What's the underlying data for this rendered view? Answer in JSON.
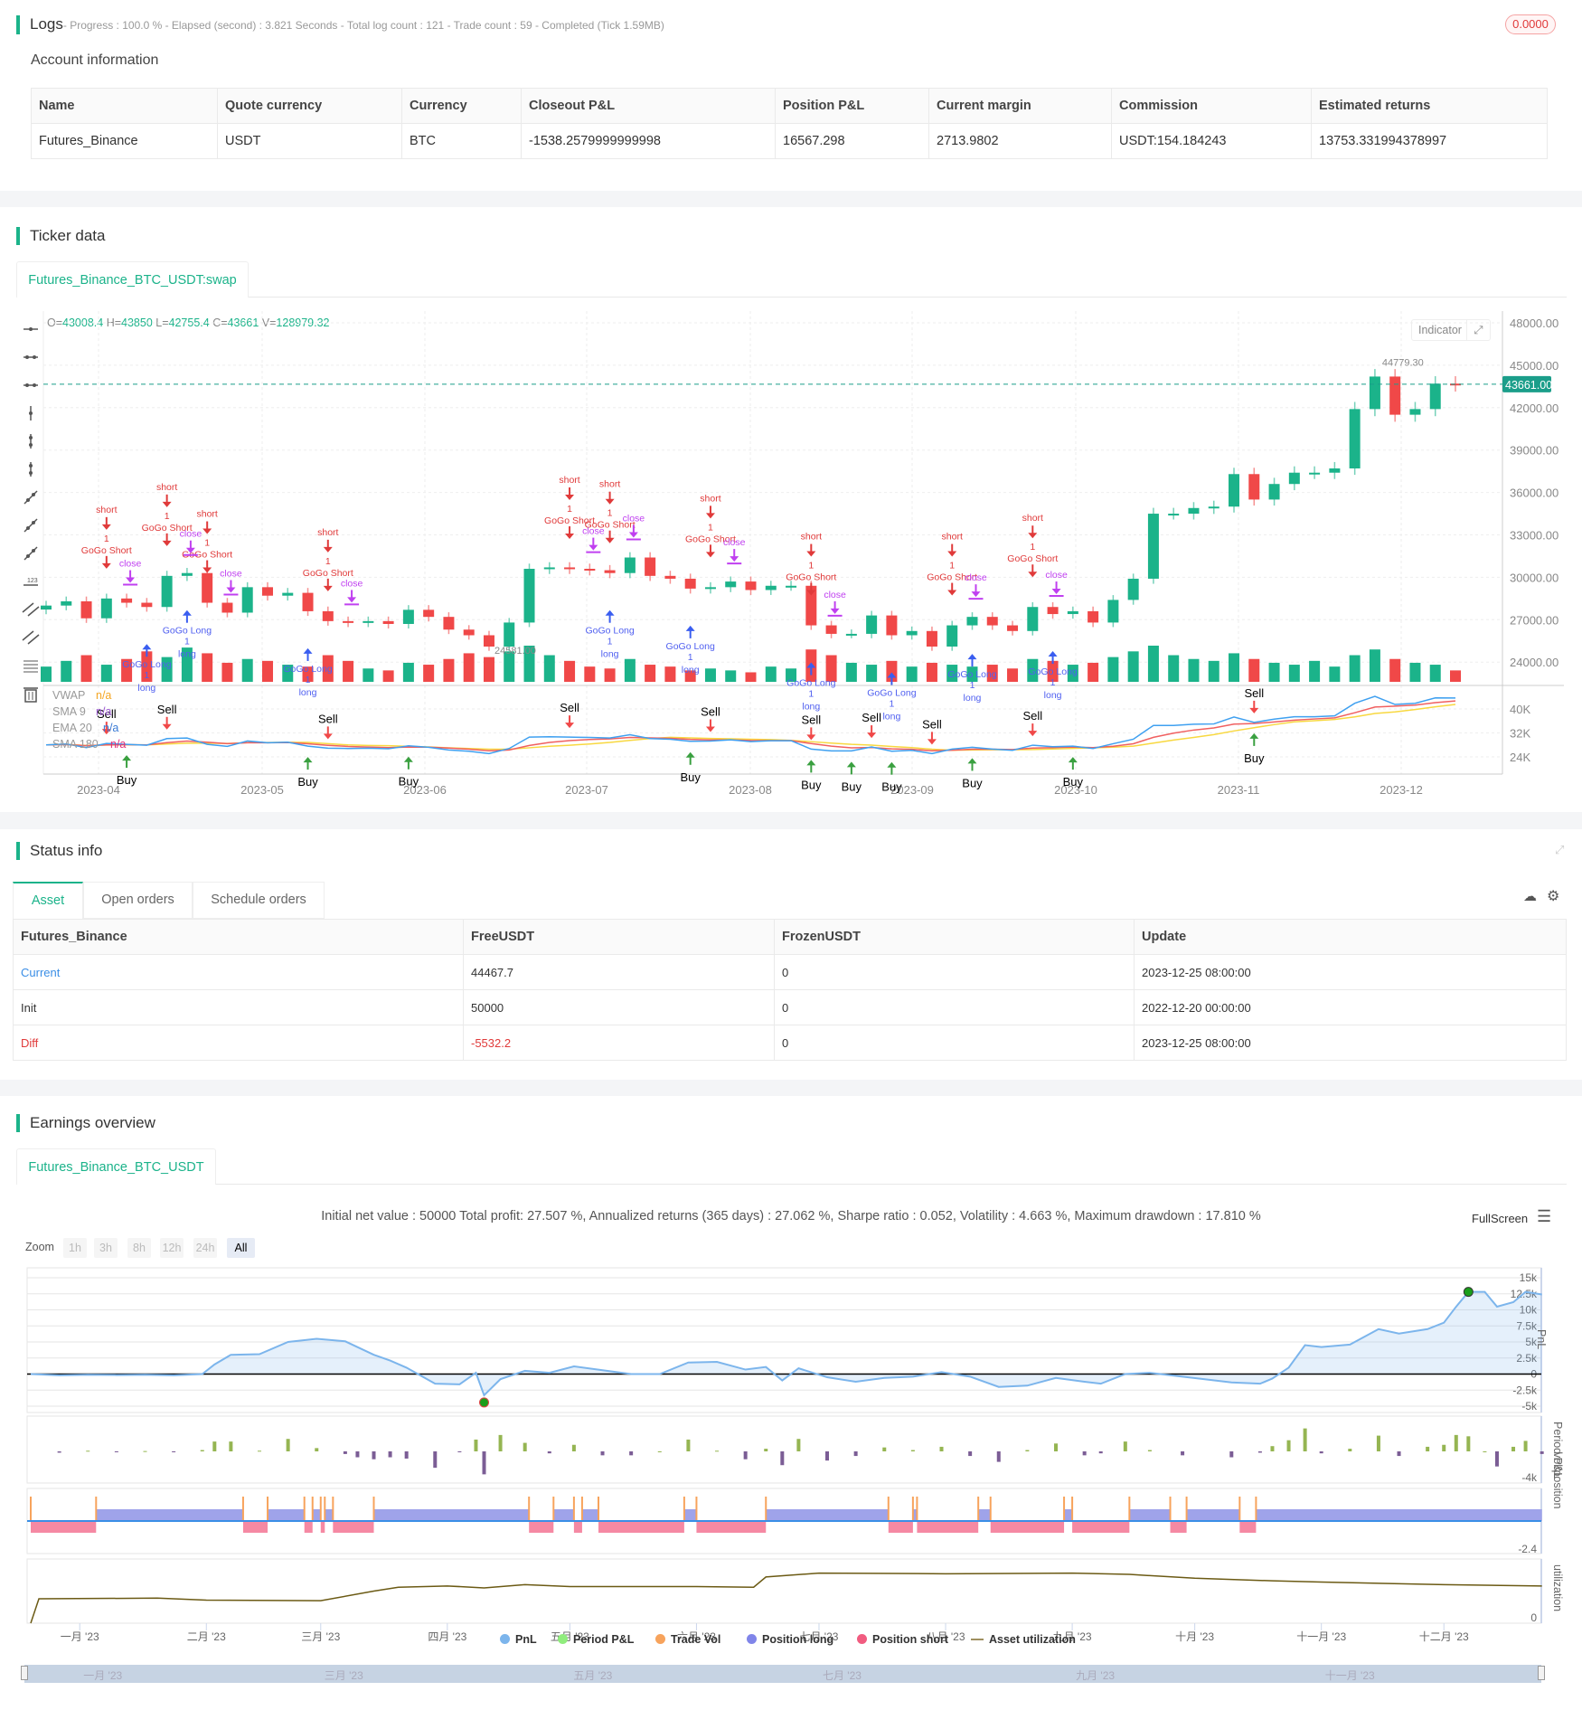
{
  "logs": {
    "title": "Logs",
    "meta": "- Progress : 100.0 % - Elapsed (second) : 3.821  Seconds - Total log count : 121 - Trade count : 59 - Completed (Tick 1.59MB)",
    "badge": "0.0000"
  },
  "account": {
    "title": "Account information",
    "headers": [
      "Name",
      "Quote currency",
      "Currency",
      "Closeout P&L",
      "Position P&L",
      "Current margin",
      "Commission",
      "Estimated returns"
    ],
    "row": [
      "Futures_Binance",
      "USDT",
      "BTC",
      "-1538.2579999999998",
      "16567.298",
      "2713.9802",
      "USDT:154.184243",
      "13753.331994378997"
    ]
  },
  "ticker": {
    "title": "Ticker data",
    "tab": "Futures_Binance_BTC_USDT:swap",
    "ohlcv": {
      "o_label": "O=",
      "o": "43008.4",
      "h_label": " H=",
      "h": "43850",
      "l_label": " L=",
      "l": "42755.4",
      "c_label": " C=",
      "c": "43661",
      "v_label": " V=",
      "v": "128979.32"
    },
    "indicator_button": "Indicator",
    "tools": [
      "horizontal-ray-icon",
      "horizontal-segment-icon",
      "horizontal-line-icon",
      "vertical-ray-icon",
      "vertical-segment-icon",
      "vertical-line-icon",
      "ray-icon",
      "segment-icon",
      "straight-line-icon",
      "price-line-icon",
      "parallel-channel-icon",
      "price-channel-icon",
      "fibonacci-icon",
      "delete-icon"
    ],
    "indicators": [
      {
        "name": "VWAP",
        "value": "n/a",
        "color": "#f5a623"
      },
      {
        "name": "SMA 9",
        "value": "n/a",
        "color": "#9b59d0"
      },
      {
        "name": "EMA 20",
        "value": "n/a",
        "color": "#3a7bd5"
      },
      {
        "name": "SMA 180",
        "value": "n/a",
        "color": "#e0307a"
      }
    ],
    "marker_labels": {
      "short": "short",
      "qty": "1",
      "gogo_short": "GoGo Short",
      "close": "close",
      "gogo_long": "GoGo Long",
      "long": "long",
      "sell": "Sell",
      "buy": "Buy"
    },
    "last_price": "43661.00",
    "max_label": "44779.30",
    "min_label": "24581.00"
  },
  "chart_data": [
    {
      "type": "candlestick",
      "price_ticks": [
        "48000.00",
        "45000.00",
        "42000.00",
        "39000.00",
        "36000.00",
        "33000.00",
        "30000.00",
        "27000.00",
        "24000.00"
      ],
      "price_ylim": [
        24000,
        48000
      ],
      "indicator_ticks": [
        "40K",
        "32K",
        "24K"
      ],
      "x_ticks": [
        "2023-04",
        "2023-05",
        "2023-06",
        "2023-07",
        "2023-08",
        "2023-09",
        "2023-10",
        "2023-11",
        "2023-12"
      ],
      "closes": [
        28000,
        28300,
        27100,
        28500,
        28200,
        27900,
        30100,
        30300,
        28200,
        27500,
        29300,
        28700,
        28900,
        27600,
        26900,
        26800,
        26900,
        26700,
        27700,
        27200,
        26300,
        25900,
        25100,
        26800,
        30600,
        30700,
        30600,
        30500,
        30300,
        31400,
        30100,
        29900,
        29200,
        29300,
        29700,
        29100,
        29400,
        29400,
        26600,
        26000,
        26000,
        27300,
        25900,
        26200,
        25100,
        26600,
        27200,
        26600,
        26200,
        27900,
        27400,
        27600,
        26800,
        28400,
        29900,
        34500,
        34500,
        34900,
        35000,
        37300,
        35500,
        36600,
        37400,
        37400,
        37700,
        41900,
        44200,
        41500,
        41900,
        43700,
        43661
      ],
      "volumes": [
        40,
        55,
        70,
        45,
        60,
        80,
        65,
        90,
        75,
        50,
        60,
        55,
        45,
        40,
        70,
        55,
        35,
        30,
        50,
        45,
        60,
        75,
        65,
        80,
        95,
        70,
        55,
        40,
        35,
        60,
        45,
        40,
        30,
        35,
        30,
        25,
        40,
        35,
        85,
        70,
        50,
        45,
        55,
        40,
        50,
        45,
        40,
        45,
        35,
        60,
        55,
        45,
        50,
        65,
        80,
        95,
        70,
        60,
        55,
        75,
        60,
        50,
        45,
        55,
        40,
        70,
        85,
        60,
        50,
        45,
        30
      ],
      "signals": {
        "short": [
          3,
          6,
          8,
          14,
          26,
          28,
          33,
          38,
          45,
          49
        ],
        "close": [
          4,
          7,
          9,
          15,
          27,
          29,
          34,
          39,
          46,
          50
        ],
        "long": [
          5,
          7,
          13,
          28,
          32,
          38,
          42,
          46,
          50
        ],
        "sell": [
          3,
          6,
          14,
          26,
          33,
          38,
          41,
          44,
          49,
          60
        ],
        "buy": [
          4,
          13,
          18,
          32,
          38,
          40,
          42,
          46,
          51,
          60
        ]
      },
      "colors": {
        "up": "#1bb38a",
        "down": "#f04848",
        "close_line": "#3fa0f0",
        "ema": "#f06060",
        "sma": "#f8d840"
      }
    },
    {
      "type": "line",
      "series": [
        {
          "name": "PnL",
          "points": [
            [
              "2022-12-20",
              0
            ],
            [
              "2022-12-27",
              -200
            ],
            [
              "2023-01-03",
              -100
            ],
            [
              "2023-01-10",
              -150
            ],
            [
              "2023-01-17",
              -100
            ],
            [
              "2023-01-24",
              -200
            ],
            [
              "2023-01-31",
              0
            ],
            [
              "2023-02-03",
              1500
            ],
            [
              "2023-02-07",
              3000
            ],
            [
              "2023-02-14",
              3100
            ],
            [
              "2023-02-21",
              5000
            ],
            [
              "2023-02-28",
              5500
            ],
            [
              "2023-03-07",
              5100
            ],
            [
              "2023-03-10",
              4200
            ],
            [
              "2023-03-14",
              3000
            ],
            [
              "2023-03-18",
              2100
            ],
            [
              "2023-03-22",
              1000
            ],
            [
              "2023-03-29",
              -1500
            ],
            [
              "2023-04-04",
              -1600
            ],
            [
              "2023-04-08",
              200
            ],
            [
              "2023-04-10",
              -3300
            ],
            [
              "2023-04-14",
              -800
            ],
            [
              "2023-04-20",
              500
            ],
            [
              "2023-04-26",
              200
            ],
            [
              "2023-05-02",
              1200
            ],
            [
              "2023-05-09",
              600
            ],
            [
              "2023-05-16",
              0
            ],
            [
              "2023-05-23",
              0
            ],
            [
              "2023-05-30",
              1800
            ],
            [
              "2023-06-06",
              1900
            ],
            [
              "2023-06-13",
              700
            ],
            [
              "2023-06-18",
              1100
            ],
            [
              "2023-06-22",
              -1000
            ],
            [
              "2023-06-26",
              900
            ],
            [
              "2023-07-03",
              -500
            ],
            [
              "2023-07-10",
              -1200
            ],
            [
              "2023-07-17",
              -600
            ],
            [
              "2023-07-24",
              -400
            ],
            [
              "2023-07-31",
              300
            ],
            [
              "2023-08-07",
              -400
            ],
            [
              "2023-08-14",
              -2000
            ],
            [
              "2023-08-21",
              -1800
            ],
            [
              "2023-08-28",
              -600
            ],
            [
              "2023-09-04",
              -1200
            ],
            [
              "2023-09-08",
              -1500
            ],
            [
              "2023-09-14",
              0
            ],
            [
              "2023-09-20",
              200
            ],
            [
              "2023-09-28",
              -400
            ],
            [
              "2023-10-10",
              -1300
            ],
            [
              "2023-10-17",
              -1500
            ],
            [
              "2023-10-20",
              -700
            ],
            [
              "2023-10-24",
              1000
            ],
            [
              "2023-10-28",
              4500
            ],
            [
              "2023-11-01",
              4200
            ],
            [
              "2023-11-08",
              4600
            ],
            [
              "2023-11-15",
              7000
            ],
            [
              "2023-11-20",
              6300
            ],
            [
              "2023-11-27",
              7000
            ],
            [
              "2023-12-01",
              8000
            ],
            [
              "2023-12-04",
              10500
            ],
            [
              "2023-12-07",
              12800
            ],
            [
              "2023-12-11",
              12800
            ],
            [
              "2023-12-14",
              10500
            ],
            [
              "2023-12-18",
              11200
            ],
            [
              "2023-12-21",
              12800
            ],
            [
              "2023-12-25",
              12400
            ]
          ]
        }
      ],
      "pnl_ticks": [
        "15k",
        "12.5k",
        "10k",
        "7.5k",
        "5k",
        "2.5k",
        "0",
        "-2.5k",
        "-5k"
      ],
      "pnl_ylim": [
        -5000,
        15000
      ],
      "period_tick": "-4k",
      "position_tick": "-2.4",
      "utilization_tick": "0",
      "positions": [
        [
          "2022-12-20",
          "2023-01-05",
          "short"
        ],
        [
          "2023-01-05",
          "2023-02-10",
          "long"
        ],
        [
          "2023-02-10",
          "2023-02-16",
          "short"
        ],
        [
          "2023-02-16",
          "2023-02-25",
          "long"
        ],
        [
          "2023-02-25",
          "2023-02-27",
          "short"
        ],
        [
          "2023-02-27",
          "2023-03-01",
          "long"
        ],
        [
          "2023-03-01",
          "2023-03-02",
          "short"
        ],
        [
          "2023-03-02",
          "2023-03-04",
          "long"
        ],
        [
          "2023-03-04",
          "2023-03-14",
          "short"
        ],
        [
          "2023-03-14",
          "2023-04-21",
          "long"
        ],
        [
          "2023-04-21",
          "2023-04-27",
          "short"
        ],
        [
          "2023-04-27",
          "2023-05-02",
          "long"
        ],
        [
          "2023-05-02",
          "2023-05-04",
          "short"
        ],
        [
          "2023-05-04",
          "2023-05-08",
          "long"
        ],
        [
          "2023-05-08",
          "2023-05-29",
          "short"
        ],
        [
          "2023-05-29",
          "2023-06-01",
          "long"
        ],
        [
          "2023-06-01",
          "2023-06-18",
          "short"
        ],
        [
          "2023-06-18",
          "2023-07-18",
          "long"
        ],
        [
          "2023-07-18",
          "2023-07-24",
          "short"
        ],
        [
          "2023-07-24",
          "2023-07-25",
          "long"
        ],
        [
          "2023-07-25",
          "2023-08-09",
          "short"
        ],
        [
          "2023-08-09",
          "2023-08-12",
          "long"
        ],
        [
          "2023-08-12",
          "2023-08-30",
          "short"
        ],
        [
          "2023-08-30",
          "2023-09-01",
          "long"
        ],
        [
          "2023-09-01",
          "2023-09-15",
          "short"
        ],
        [
          "2023-09-15",
          "2023-09-25",
          "long"
        ],
        [
          "2023-09-25",
          "2023-09-29",
          "short"
        ],
        [
          "2023-09-29",
          "2023-10-12",
          "long"
        ],
        [
          "2023-10-12",
          "2023-10-16",
          "short"
        ],
        [
          "2023-10-16",
          "2023-12-25",
          "long"
        ]
      ],
      "utilization": [
        [
          "2022-12-22",
          0.38
        ],
        [
          "2023-01-20",
          0.39
        ],
        [
          "2023-02-01",
          0.36
        ],
        [
          "2023-03-01",
          0.35
        ],
        [
          "2023-03-14",
          0.5
        ],
        [
          "2023-03-20",
          0.56
        ],
        [
          "2023-04-01",
          0.58
        ],
        [
          "2023-04-10",
          0.55
        ],
        [
          "2023-04-20",
          0.6
        ],
        [
          "2023-05-01",
          0.57
        ],
        [
          "2023-06-01",
          0.57
        ],
        [
          "2023-06-15",
          0.56
        ],
        [
          "2023-06-18",
          0.72
        ],
        [
          "2023-07-01",
          0.78
        ],
        [
          "2023-08-01",
          0.77
        ],
        [
          "2023-09-01",
          0.78
        ],
        [
          "2023-09-15",
          0.76
        ],
        [
          "2023-10-01",
          0.7
        ],
        [
          "2023-10-20",
          0.66
        ],
        [
          "2023-11-01",
          0.64
        ],
        [
          "2023-12-01",
          0.6
        ],
        [
          "2023-12-25",
          0.58
        ]
      ],
      "x_ticks": [
        [
          "2023-01-01",
          "一月 '23"
        ],
        [
          "2023-02-01",
          "二月 '23"
        ],
        [
          "2023-03-01",
          "三月 '23"
        ],
        [
          "2023-04-01",
          "四月 '23"
        ],
        [
          "2023-05-01",
          "五月 '23"
        ],
        [
          "2023-06-01",
          "六月 '23"
        ],
        [
          "2023-07-01",
          "七月 '23"
        ],
        [
          "2023-08-01",
          "八月 '23"
        ],
        [
          "2023-09-01",
          "九月 '23"
        ],
        [
          "2023-10-01",
          "十月 '23"
        ],
        [
          "2023-11-01",
          "十一月 '23"
        ],
        [
          "2023-12-01",
          "十二月 '23"
        ]
      ],
      "navigator_ticks": [
        [
          "2023-01-01",
          "一月 '23"
        ],
        [
          "2023-03-01",
          "三月 '23"
        ],
        [
          "2023-05-01",
          "五月 '23"
        ],
        [
          "2023-07-01",
          "七月 '23"
        ],
        [
          "2023-09-01",
          "九月 '23"
        ],
        [
          "2023-11-01",
          "十一月 '23"
        ]
      ],
      "colors": {
        "pnl": "#7cb5ec",
        "period_pos": "#95b552",
        "period_neg": "#7b5d95",
        "trade_vol": "#f7a35c",
        "long": "#9fa3ea",
        "short": "#f589a3",
        "utilization": "#6b5a14"
      }
    }
  ],
  "status": {
    "title": "Status info",
    "tabs": [
      "Asset",
      "Open orders",
      "Schedule orders"
    ],
    "headers": [
      "Futures_Binance",
      "FreeUSDT",
      "FrozenUSDT",
      "Update"
    ],
    "rows": [
      [
        "Current",
        "44467.7",
        "0",
        "2023-12-25 08:00:00"
      ],
      [
        "Init",
        "50000",
        "0",
        "2022-12-20 00:00:00"
      ],
      [
        "Diff",
        "-5532.2",
        "0",
        "2023-12-25 08:00:00"
      ]
    ]
  },
  "earnings": {
    "title": "Earnings overview",
    "tab": "Futures_Binance_BTC_USDT",
    "summary": "Initial net value : 50000 Total profit: 27.507 %, Annualized returns (365 days) : 27.062 %, Sharpe ratio : 0.052, Volatility : 4.663 %, Maximum drawdown : 17.810 %",
    "fullscreen": "FullScreen",
    "zoom_label": "Zoom",
    "zoom_buttons": [
      "1h",
      "3h",
      "8h",
      "12h",
      "24h",
      "All"
    ],
    "axis_titles": [
      "PnL",
      "Period P&L",
      "vol/position",
      "utilization"
    ],
    "legend": [
      "PnL",
      "Period P&L",
      "Trade Vol",
      "Position long",
      "Position short",
      "Asset utilization"
    ]
  }
}
